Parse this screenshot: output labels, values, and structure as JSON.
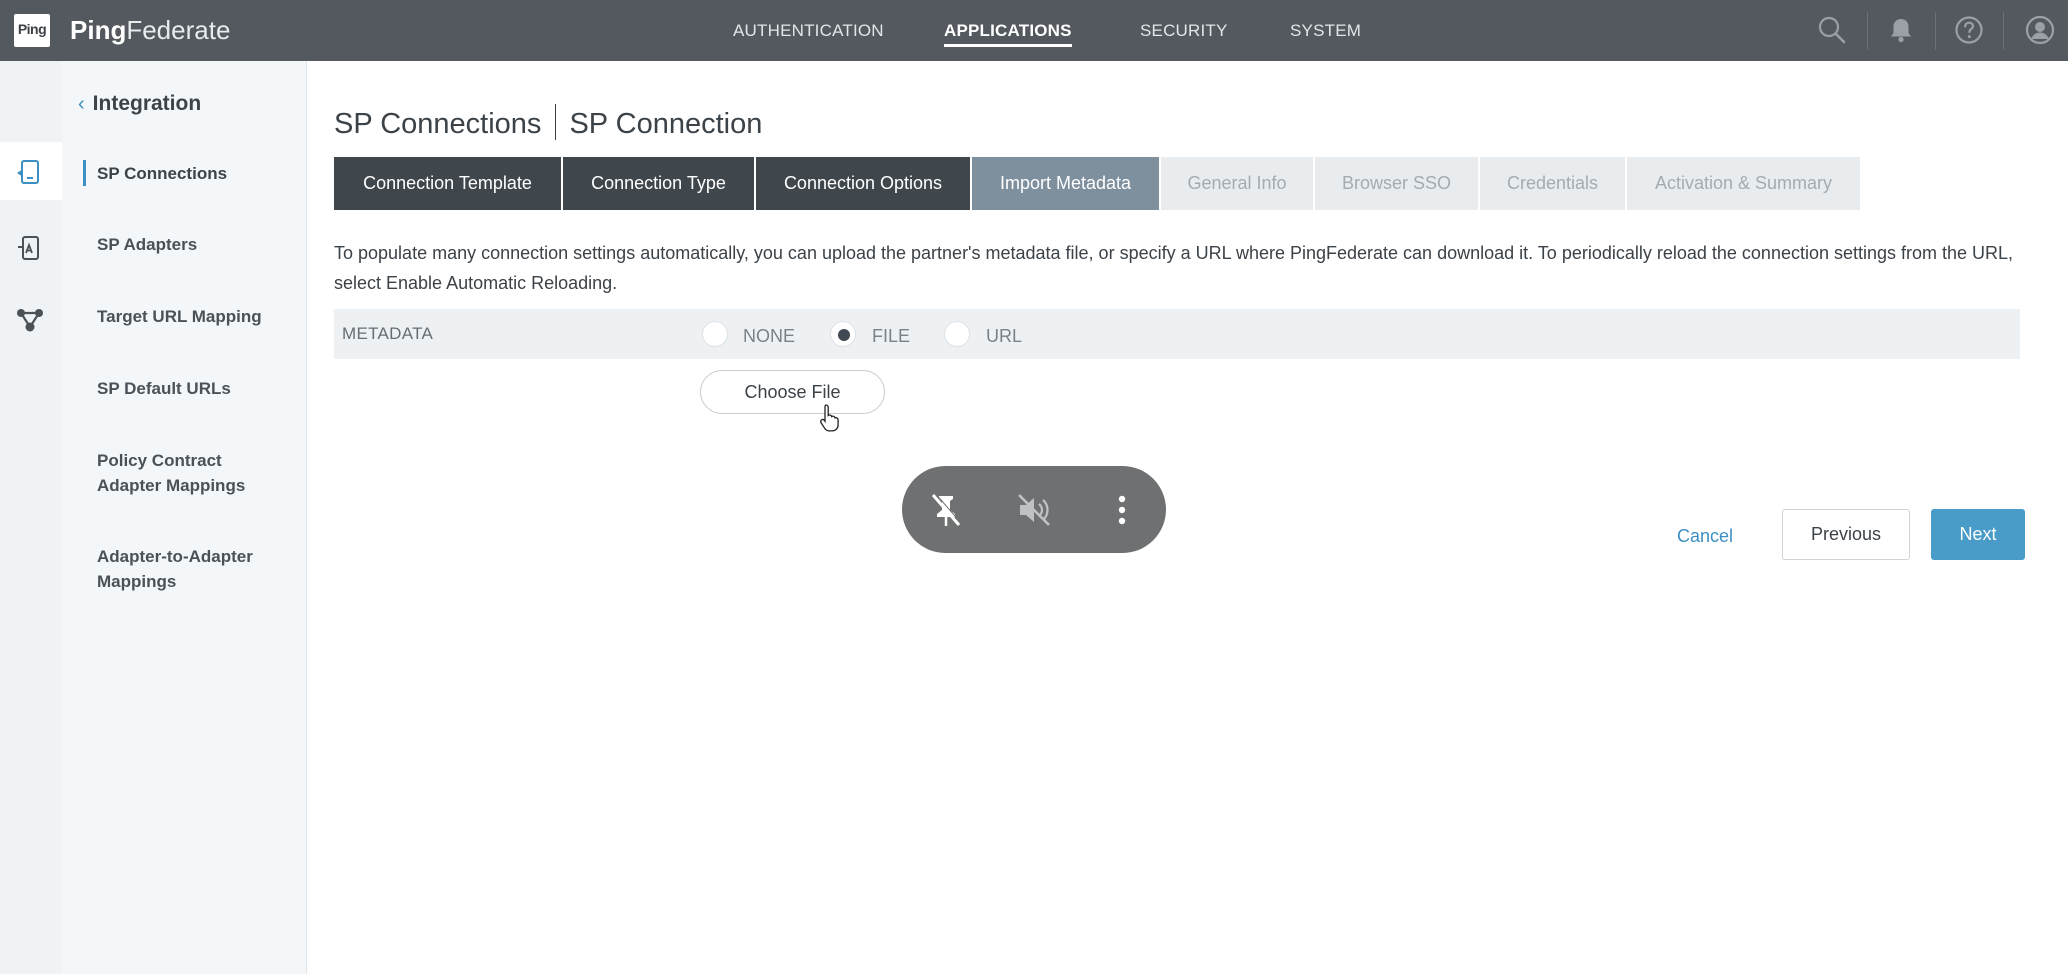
{
  "header": {
    "logo_text": "Ping",
    "brand_bold": "Ping",
    "brand_light": "Federate",
    "nav": [
      {
        "label": "AUTHENTICATION",
        "active": false
      },
      {
        "label": "APPLICATIONS",
        "active": true
      },
      {
        "label": "SECURITY",
        "active": false
      },
      {
        "label": "SYSTEM",
        "active": false
      }
    ],
    "icons": [
      "search-icon",
      "bell-icon",
      "help-icon",
      "user-icon"
    ]
  },
  "rail": {
    "icons": [
      "sp-connection-icon",
      "sp-adapter-icon",
      "integration-network-icon"
    ],
    "active_index": 0
  },
  "sidebar": {
    "back_label": "Integration",
    "items": [
      {
        "label": "SP Connections",
        "active": true
      },
      {
        "label": "SP Adapters",
        "active": false
      },
      {
        "label": "Target URL Mapping",
        "active": false
      },
      {
        "label": "SP Default URLs",
        "active": false
      },
      {
        "label": "Policy Contract Adapter Mappings",
        "active": false
      },
      {
        "label": "Adapter-to-Adapter Mappings",
        "active": false
      }
    ]
  },
  "main": {
    "breadcrumb_parent": "SP Connections",
    "breadcrumb_current": "SP Connection",
    "tabs": [
      {
        "label": "Connection Template",
        "state": "done"
      },
      {
        "label": "Connection Type",
        "state": "done"
      },
      {
        "label": "Connection Options",
        "state": "done"
      },
      {
        "label": "Import Metadata",
        "state": "current"
      },
      {
        "label": "General Info",
        "state": "todo"
      },
      {
        "label": "Browser SSO",
        "state": "todo"
      },
      {
        "label": "Credentials",
        "state": "todo"
      },
      {
        "label": "Activation & Summary",
        "state": "todo"
      }
    ],
    "description": "To populate many connection settings automatically, you can upload the partner's metadata file, or specify a URL where PingFederate can download it. To periodically reload the connection settings from the URL, select Enable Automatic Reloading.",
    "metadata": {
      "label": "METADATA",
      "options": [
        {
          "label": "NONE",
          "checked": false
        },
        {
          "label": "FILE",
          "checked": true
        },
        {
          "label": "URL",
          "checked": false
        }
      ],
      "choose_file_label": "Choose File"
    },
    "actions": {
      "cancel": "Cancel",
      "previous": "Previous",
      "next": "Next"
    }
  },
  "overlay": {
    "icons": [
      "unpin-icon",
      "mute-icon",
      "more-vertical-icon"
    ]
  }
}
